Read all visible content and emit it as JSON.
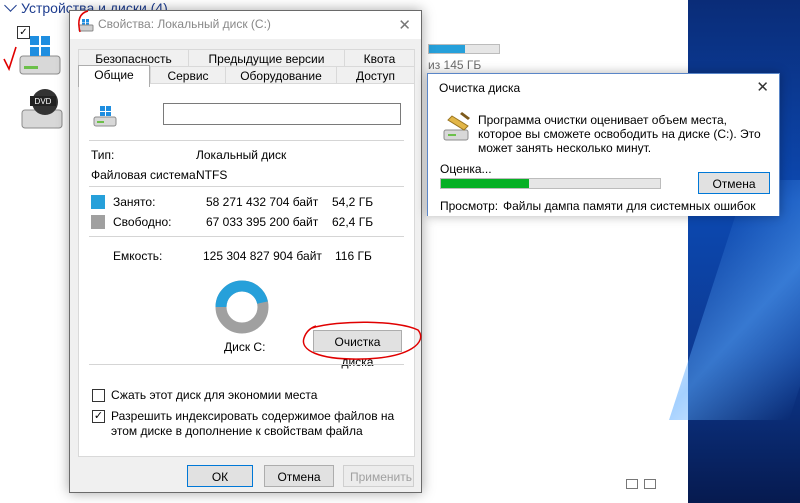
{
  "explorer": {
    "group_header": "Устройства и диски (4)",
    "bg_free_text": "из 145 ГБ",
    "bg_bar_fraction": 0.52
  },
  "properties": {
    "title": "Свойства: Локальный диск (C:)",
    "tabs_top": [
      "Безопасность",
      "Предыдущие версии",
      "Квота"
    ],
    "tabs_bottom": [
      "Общие",
      "Сервис",
      "Оборудование",
      "Доступ"
    ],
    "active_tab": "Общие",
    "name_value": "",
    "type_label": "Тип:",
    "type_value": "Локальный диск",
    "fs_label": "Файловая система:",
    "fs_value": "NTFS",
    "used_label": "Занято:",
    "used_bytes": "58 271 432 704 байт",
    "used_gb": "54,2 ГБ",
    "free_label": "Свободно:",
    "free_bytes": "67 033 395 200 байт",
    "free_gb": "62,4 ГБ",
    "capacity_label": "Емкость:",
    "capacity_bytes": "125 304 827 904 байт",
    "capacity_gb": "116 ГБ",
    "drive_label": "Диск C:",
    "cleanup_button": "Очистка диска",
    "compress_label": "Сжать этот диск для экономии места",
    "compress_checked": false,
    "index_label": "Разрешить индексировать содержимое файлов на этом диске в дополнение к свойствам файла",
    "index_checked": true,
    "ok_button": "ОК",
    "cancel_button": "Отмена",
    "apply_button": "Применить",
    "used_fraction": 0.465,
    "colors": {
      "used": "#26a0da",
      "free": "#a0a0a0"
    }
  },
  "cleanup_dialog": {
    "title": "Очистка диска",
    "message": "Программа очистки оценивает объем места, которое вы сможете освободить на диске  (C:). Это может занять несколько минут.",
    "progress_label": "Оценка...",
    "progress_fraction": 0.4,
    "cancel_button": "Отмена",
    "scan_label": "Просмотр:",
    "scan_value": "Файлы дампа памяти для системных ошибок"
  }
}
